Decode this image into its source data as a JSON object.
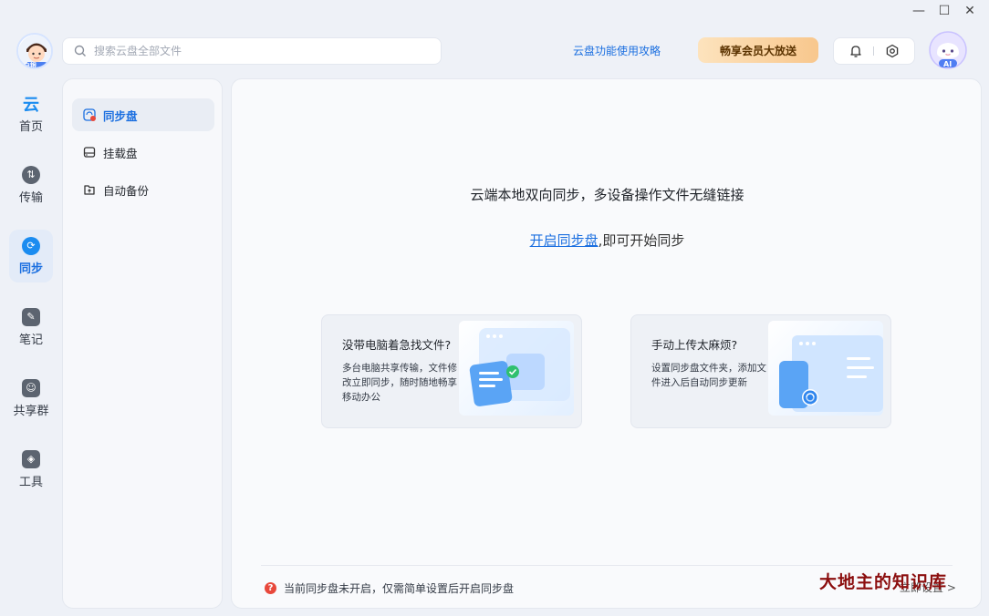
{
  "window": {
    "minimize": "—",
    "maximize": "☐",
    "close": "✕"
  },
  "header": {
    "search_placeholder": "搜索云盘全部文件",
    "guide_link": "云盘功能使用攻略",
    "vip_button": "畅享会员大放送",
    "avatar_badge": "白银",
    "ai_badge": "AI"
  },
  "nav": {
    "items": [
      {
        "label": "首页",
        "icon": "home-icon"
      },
      {
        "label": "传输",
        "icon": "transfer-icon"
      },
      {
        "label": "同步",
        "icon": "sync-icon",
        "active": true
      },
      {
        "label": "笔记",
        "icon": "note-icon"
      },
      {
        "label": "共享群",
        "icon": "group-icon"
      },
      {
        "label": "工具",
        "icon": "tools-icon"
      }
    ]
  },
  "subnav": {
    "items": [
      {
        "label": "同步盘",
        "active": true
      },
      {
        "label": "挂载盘"
      },
      {
        "label": "自动备份"
      }
    ]
  },
  "main": {
    "headline": "云端本地双向同步，多设备操作文件无缝链接",
    "sub_link": "开启同步盘",
    "sub_text": ",即可开始同步",
    "cards": [
      {
        "title": "没带电脑着急找文件?",
        "desc": "多台电脑共享传输，文件修改立即同步，随时随地畅享移动办公"
      },
      {
        "title": "手动上传太麻烦?",
        "desc": "设置同步盘文件夹，添加文件进入后自动同步更新"
      }
    ],
    "notice": "当前同步盘未开启，仅需简单设置后开启同步盘",
    "setup_link": "立即设置 >"
  },
  "watermark": "大地主的知识库",
  "colors": {
    "accent": "#1b6fe0",
    "vip_gradient_start": "#fde3bd",
    "vip_gradient_end": "#f8c78d",
    "warning": "#e8483b"
  }
}
